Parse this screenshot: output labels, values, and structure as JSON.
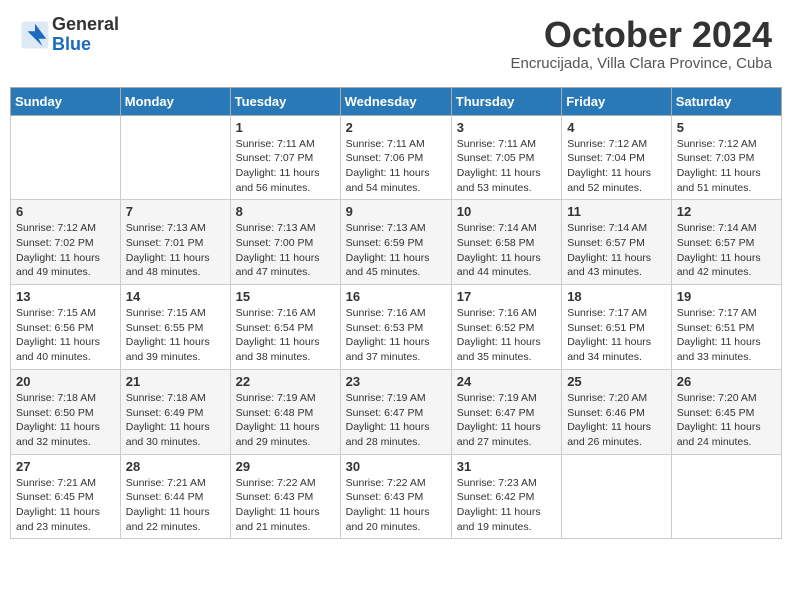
{
  "header": {
    "logo_general": "General",
    "logo_blue": "Blue",
    "month": "October 2024",
    "location": "Encrucijada, Villa Clara Province, Cuba"
  },
  "days_of_week": [
    "Sunday",
    "Monday",
    "Tuesday",
    "Wednesday",
    "Thursday",
    "Friday",
    "Saturday"
  ],
  "weeks": [
    [
      {
        "day": "",
        "info": ""
      },
      {
        "day": "",
        "info": ""
      },
      {
        "day": "1",
        "info": "Sunrise: 7:11 AM\nSunset: 7:07 PM\nDaylight: 11 hours and 56 minutes."
      },
      {
        "day": "2",
        "info": "Sunrise: 7:11 AM\nSunset: 7:06 PM\nDaylight: 11 hours and 54 minutes."
      },
      {
        "day": "3",
        "info": "Sunrise: 7:11 AM\nSunset: 7:05 PM\nDaylight: 11 hours and 53 minutes."
      },
      {
        "day": "4",
        "info": "Sunrise: 7:12 AM\nSunset: 7:04 PM\nDaylight: 11 hours and 52 minutes."
      },
      {
        "day": "5",
        "info": "Sunrise: 7:12 AM\nSunset: 7:03 PM\nDaylight: 11 hours and 51 minutes."
      }
    ],
    [
      {
        "day": "6",
        "info": "Sunrise: 7:12 AM\nSunset: 7:02 PM\nDaylight: 11 hours and 49 minutes."
      },
      {
        "day": "7",
        "info": "Sunrise: 7:13 AM\nSunset: 7:01 PM\nDaylight: 11 hours and 48 minutes."
      },
      {
        "day": "8",
        "info": "Sunrise: 7:13 AM\nSunset: 7:00 PM\nDaylight: 11 hours and 47 minutes."
      },
      {
        "day": "9",
        "info": "Sunrise: 7:13 AM\nSunset: 6:59 PM\nDaylight: 11 hours and 45 minutes."
      },
      {
        "day": "10",
        "info": "Sunrise: 7:14 AM\nSunset: 6:58 PM\nDaylight: 11 hours and 44 minutes."
      },
      {
        "day": "11",
        "info": "Sunrise: 7:14 AM\nSunset: 6:57 PM\nDaylight: 11 hours and 43 minutes."
      },
      {
        "day": "12",
        "info": "Sunrise: 7:14 AM\nSunset: 6:57 PM\nDaylight: 11 hours and 42 minutes."
      }
    ],
    [
      {
        "day": "13",
        "info": "Sunrise: 7:15 AM\nSunset: 6:56 PM\nDaylight: 11 hours and 40 minutes."
      },
      {
        "day": "14",
        "info": "Sunrise: 7:15 AM\nSunset: 6:55 PM\nDaylight: 11 hours and 39 minutes."
      },
      {
        "day": "15",
        "info": "Sunrise: 7:16 AM\nSunset: 6:54 PM\nDaylight: 11 hours and 38 minutes."
      },
      {
        "day": "16",
        "info": "Sunrise: 7:16 AM\nSunset: 6:53 PM\nDaylight: 11 hours and 37 minutes."
      },
      {
        "day": "17",
        "info": "Sunrise: 7:16 AM\nSunset: 6:52 PM\nDaylight: 11 hours and 35 minutes."
      },
      {
        "day": "18",
        "info": "Sunrise: 7:17 AM\nSunset: 6:51 PM\nDaylight: 11 hours and 34 minutes."
      },
      {
        "day": "19",
        "info": "Sunrise: 7:17 AM\nSunset: 6:51 PM\nDaylight: 11 hours and 33 minutes."
      }
    ],
    [
      {
        "day": "20",
        "info": "Sunrise: 7:18 AM\nSunset: 6:50 PM\nDaylight: 11 hours and 32 minutes."
      },
      {
        "day": "21",
        "info": "Sunrise: 7:18 AM\nSunset: 6:49 PM\nDaylight: 11 hours and 30 minutes."
      },
      {
        "day": "22",
        "info": "Sunrise: 7:19 AM\nSunset: 6:48 PM\nDaylight: 11 hours and 29 minutes."
      },
      {
        "day": "23",
        "info": "Sunrise: 7:19 AM\nSunset: 6:47 PM\nDaylight: 11 hours and 28 minutes."
      },
      {
        "day": "24",
        "info": "Sunrise: 7:19 AM\nSunset: 6:47 PM\nDaylight: 11 hours and 27 minutes."
      },
      {
        "day": "25",
        "info": "Sunrise: 7:20 AM\nSunset: 6:46 PM\nDaylight: 11 hours and 26 minutes."
      },
      {
        "day": "26",
        "info": "Sunrise: 7:20 AM\nSunset: 6:45 PM\nDaylight: 11 hours and 24 minutes."
      }
    ],
    [
      {
        "day": "27",
        "info": "Sunrise: 7:21 AM\nSunset: 6:45 PM\nDaylight: 11 hours and 23 minutes."
      },
      {
        "day": "28",
        "info": "Sunrise: 7:21 AM\nSunset: 6:44 PM\nDaylight: 11 hours and 22 minutes."
      },
      {
        "day": "29",
        "info": "Sunrise: 7:22 AM\nSunset: 6:43 PM\nDaylight: 11 hours and 21 minutes."
      },
      {
        "day": "30",
        "info": "Sunrise: 7:22 AM\nSunset: 6:43 PM\nDaylight: 11 hours and 20 minutes."
      },
      {
        "day": "31",
        "info": "Sunrise: 7:23 AM\nSunset: 6:42 PM\nDaylight: 11 hours and 19 minutes."
      },
      {
        "day": "",
        "info": ""
      },
      {
        "day": "",
        "info": ""
      }
    ]
  ]
}
